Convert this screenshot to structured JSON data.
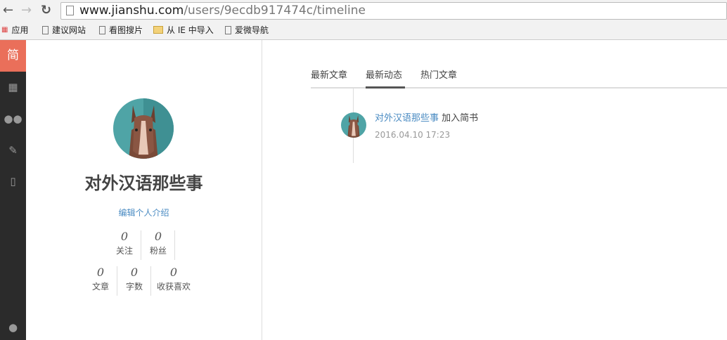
{
  "browser": {
    "url_host": "www.jianshu.com",
    "url_path": "/users/9ecdb917474c/timeline",
    "bookmarks": [
      "应用",
      "建议网站",
      "看图搜片",
      "从 IE 中导入",
      "爱微导航"
    ]
  },
  "sidebar": {
    "logo": "简"
  },
  "profile": {
    "name": "对外汉语那些事",
    "edit_intro": "编辑个人介绍",
    "stats_row1": [
      {
        "value": "0",
        "label": "关注"
      },
      {
        "value": "0",
        "label": "粉丝"
      }
    ],
    "stats_row2": [
      {
        "value": "0",
        "label": "文章"
      },
      {
        "value": "0",
        "label": "字数"
      },
      {
        "value": "0",
        "label": "收获喜欢"
      }
    ]
  },
  "tabs": [
    "最新文章",
    "最新动态",
    "热门文章"
  ],
  "timeline": [
    {
      "user": "对外汉语那些事",
      "action": "加入简书",
      "time": "2016.04.10 17:23"
    }
  ],
  "colors": {
    "accent": "#ea6f5a",
    "link": "#4a8bc2"
  }
}
